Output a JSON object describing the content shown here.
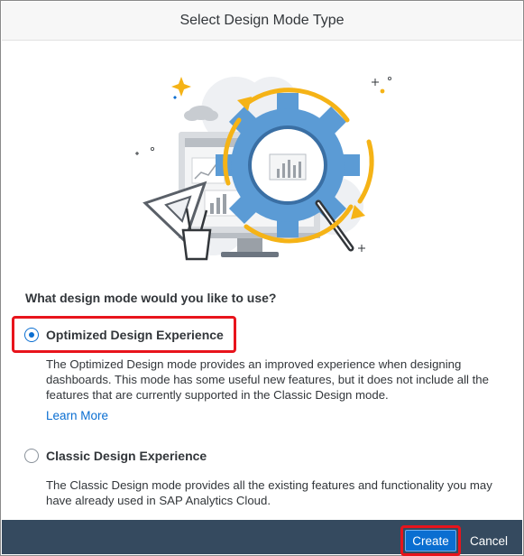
{
  "dialog": {
    "title": "Select Design Mode Type",
    "question": "What design mode would you like to use?"
  },
  "options": [
    {
      "label": "Optimized Design Experience",
      "selected": true,
      "description": "The Optimized Design mode provides an improved experience when designing dashboards. This mode has some useful new features, but it does not include all the features that are currently supported in the Classic Design mode.",
      "link": "Learn More"
    },
    {
      "label": "Classic Design Experience",
      "selected": false,
      "description": "The Classic Design mode provides all the existing features and functionality you may have already used in SAP Analytics Cloud."
    }
  ],
  "footer": {
    "create_label": "Create",
    "cancel_label": "Cancel"
  },
  "colors": {
    "accent": "#0a6ed1",
    "footer_bg": "#354a5f",
    "highlight": "#e8141c",
    "gear": "#5b9bd5",
    "arrow": "#f5b316"
  }
}
